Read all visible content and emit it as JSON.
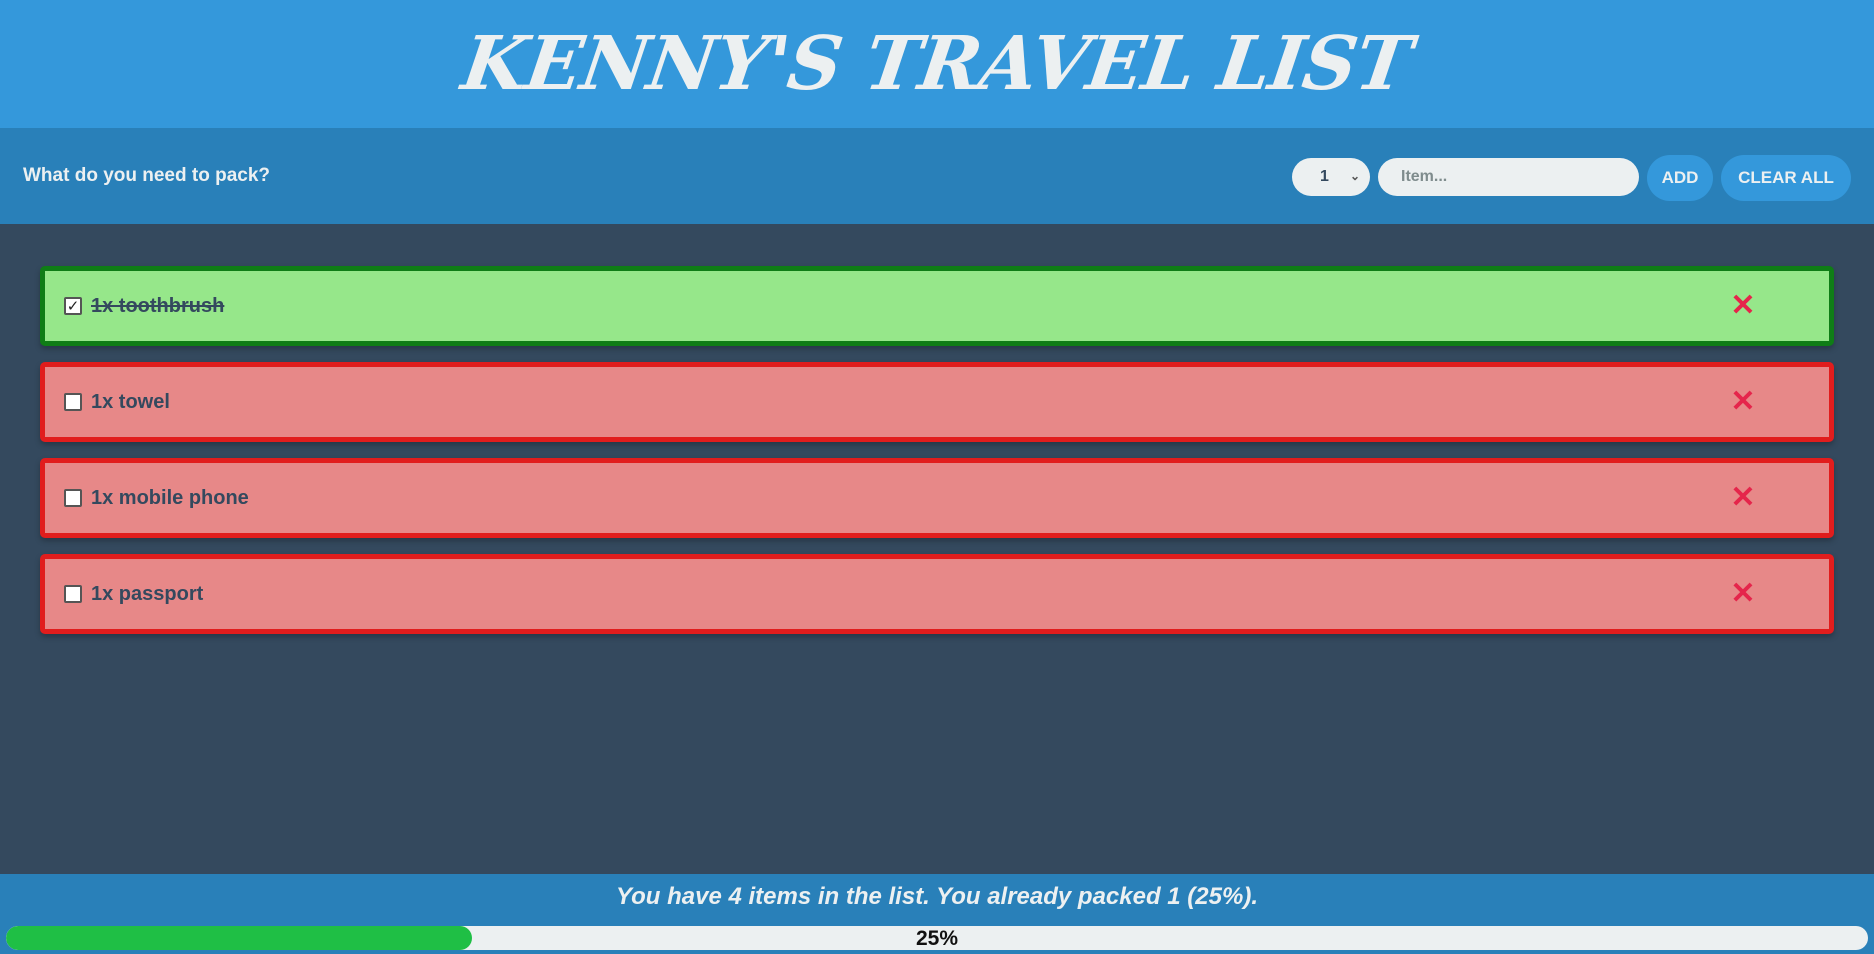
{
  "header": {
    "title": "KENNY'S TRAVEL LIST"
  },
  "add_form": {
    "prompt": "What do you need to pack?",
    "quantity_selected": "1",
    "item_placeholder": "Item...",
    "item_value": "",
    "add_label": "ADD",
    "clear_label": "CLEAR ALL"
  },
  "items": [
    {
      "label": "1x toothbrush",
      "packed": true
    },
    {
      "label": "1x towel",
      "packed": false
    },
    {
      "label": "1x mobile phone",
      "packed": false
    },
    {
      "label": "1x passport",
      "packed": false
    }
  ],
  "icons": {
    "delete": "close-icon",
    "check": "checkmark-icon",
    "select": "chevron-down-icon"
  },
  "footer": {
    "stats": "You have 4 items in the list. You already packed 1 (25%).",
    "progress_label": "25%",
    "progress_fraction": 0.25
  },
  "colors": {
    "header": "#3498db",
    "add_bar": "#2980b9",
    "background": "#34495e",
    "packed_bg": "#96e78a",
    "packed_border": "#0f7d16",
    "unpacked_bg": "#e78888",
    "unpacked_border": "#e11d1d",
    "delete_icon": "#e5254b",
    "progress_fill": "#1fbf45"
  }
}
